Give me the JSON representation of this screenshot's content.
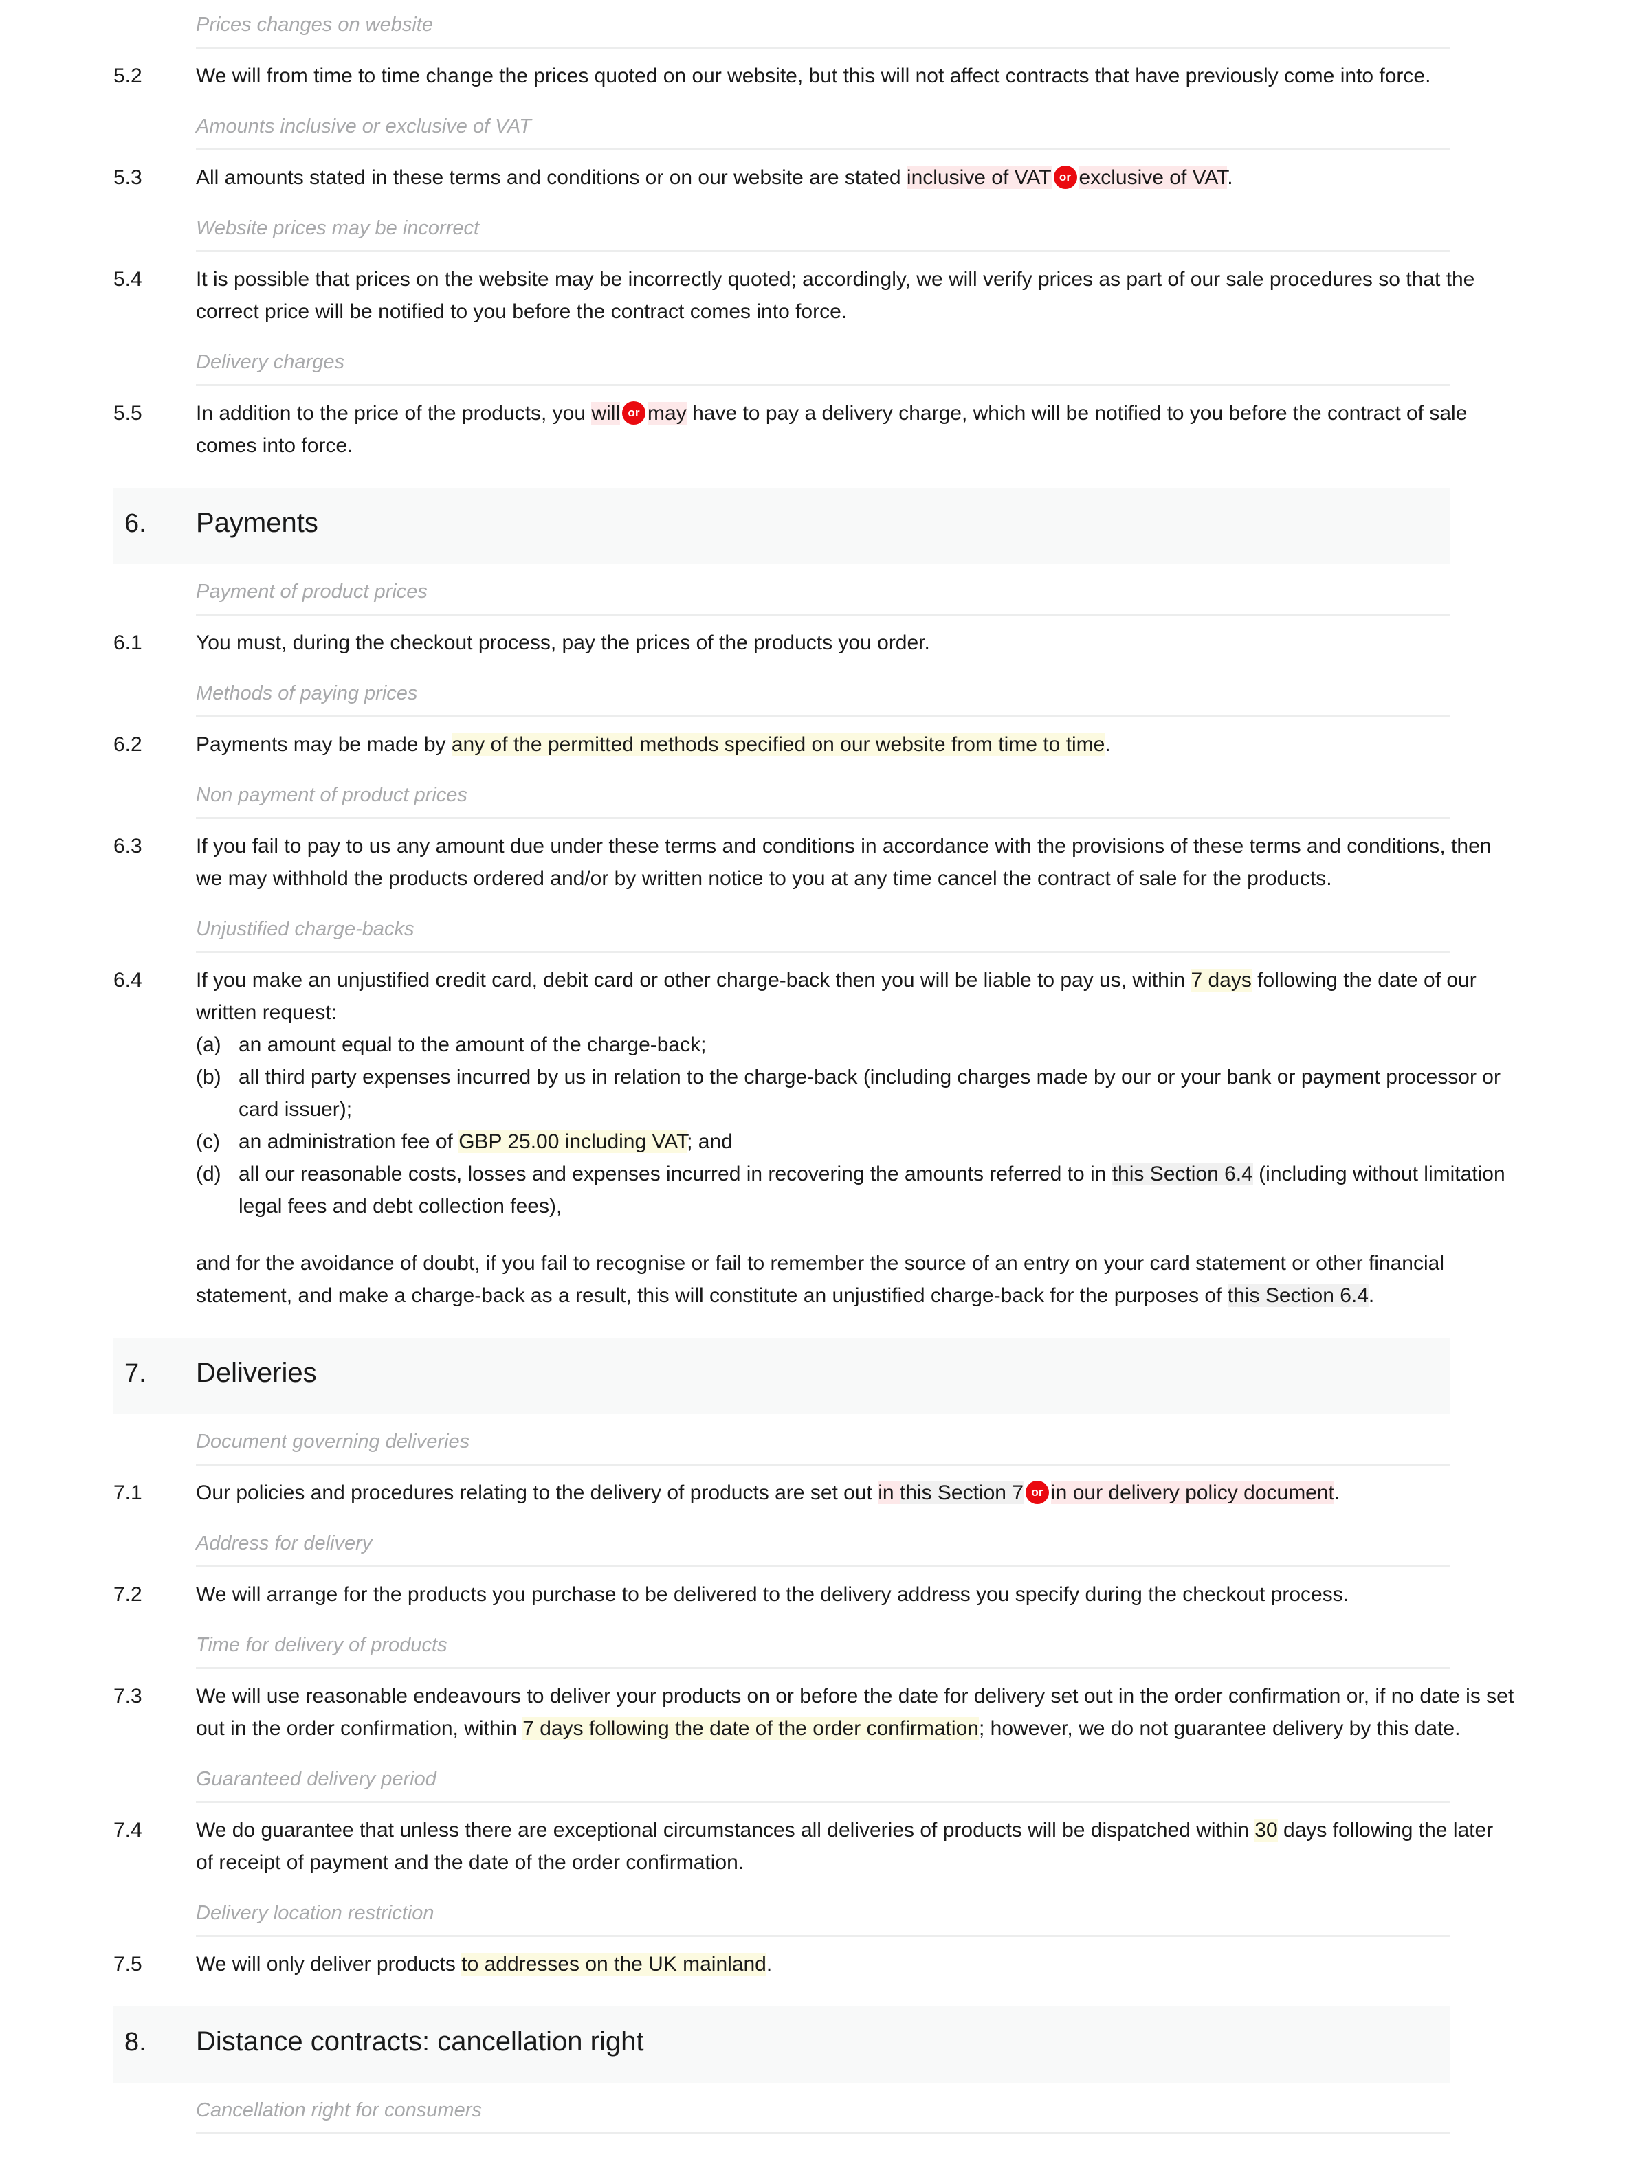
{
  "colors": {
    "text": "#1a1a1a",
    "subheading": "#a8a9ab",
    "rule": "#eceded",
    "section_band": "#f8f9f9",
    "highlight_pink": "#fde8e9",
    "highlight_yellow": "#fcfae0",
    "highlight_grey": "#f0f0f0",
    "or_badge": "#ea0a10"
  },
  "or_badge_label": "or",
  "blocks": {
    "sub_5_1": "Prices changes on website",
    "c_5_2_num": "5.2",
    "c_5_2_text": "We will from time to time change the prices quoted on our website, but this will not affect contracts that have previously come into force.",
    "sub_5_3": "Amounts inclusive or exclusive of VAT",
    "c_5_3_num": "5.3",
    "c_5_3_a": "All amounts stated in these terms and conditions or on our website are stated ",
    "c_5_3_opt1": "inclusive of VAT",
    "c_5_3_opt2": "exclusive of VAT",
    "c_5_3_b": ".",
    "sub_5_4": "Website prices may be incorrect",
    "c_5_4_num": "5.4",
    "c_5_4_text": "It is possible that prices on the website may be incorrectly quoted; accordingly, we will verify prices as part of our sale procedures so that the correct price will be notified to you before the contract comes into force.",
    "sub_5_5": "Delivery charges",
    "c_5_5_num": "5.5",
    "c_5_5_a": "In addition to the price of the products, you ",
    "c_5_5_opt1": "will",
    "c_5_5_opt2": "may",
    "c_5_5_b": " have to pay a delivery charge, which will be notified to you before the contract of sale comes into force.",
    "sec_6_num": "6.",
    "sec_6_title": "Payments",
    "sub_6_1": "Payment of product prices",
    "c_6_1_num": "6.1",
    "c_6_1_text": "You must, during the checkout process, pay the prices of the products you order.",
    "sub_6_2": "Methods of paying prices",
    "c_6_2_num": "6.2",
    "c_6_2_a": "Payments may be made by ",
    "c_6_2_hl": "any of the permitted methods specified on our website from time to time",
    "c_6_2_b": ".",
    "sub_6_3": "Non payment of product prices",
    "c_6_3_num": "6.3",
    "c_6_3_text": "If you fail to pay to us any amount due under these terms and conditions in accordance with the provisions of these terms and conditions, then we may withhold the products ordered and/or by written notice to you at any time cancel the contract of sale for the products.",
    "sub_6_4": "Unjustified charge-backs",
    "c_6_4_num": "6.4",
    "c_6_4_a": "If you make an unjustified credit card, debit card or other charge-back then you will be liable to pay us, within ",
    "c_6_4_hl": "7 days",
    "c_6_4_b": " following the date of our written request:",
    "c_6_4_items": [
      {
        "marker": "(a)",
        "text": "an amount equal to the amount of the charge-back;"
      },
      {
        "marker": "(b)",
        "text": "all third party expenses incurred by us in relation to the charge-back (including charges made by our or your bank or payment processor or card issuer);"
      },
      {
        "marker": "(c)",
        "pre": "an administration fee of ",
        "hl": "GBP 25.00 including VAT",
        "post": "; and"
      },
      {
        "marker": "(d)",
        "pre": "all our reasonable costs, losses and expenses incurred in recovering the amounts referred to in ",
        "ref": "this Section 6.4",
        "post": " (including without limitation legal fees and debt collection fees),"
      }
    ],
    "c_6_4_tail_a": "and for the avoidance of doubt, if you fail to recognise or fail to remember the source of an entry on your card statement or other financial statement, and make a charge-back as a result, this will constitute an unjustified charge-back for the purposes of ",
    "c_6_4_tail_ref": "this Section 6.4",
    "c_6_4_tail_b": ".",
    "sec_7_num": "7.",
    "sec_7_title": "Deliveries",
    "sub_7_1": "Document governing deliveries",
    "c_7_1_num": "7.1",
    "c_7_1_a": "Our policies and procedures relating to the delivery of products are set out ",
    "c_7_1_opt1_pre": "in ",
    "c_7_1_opt1_ref": "this Section 7",
    "c_7_1_opt2": "in our delivery policy document",
    "c_7_1_b": ".",
    "sub_7_2": "Address for delivery",
    "c_7_2_num": "7.2",
    "c_7_2_text": "We will arrange for the products you purchase to be delivered to the delivery address you specify during the checkout process.",
    "sub_7_3": "Time for delivery of products",
    "c_7_3_num": "7.3",
    "c_7_3_a": "We will use reasonable endeavours to deliver your products on or before the date for delivery set out in the order confirmation or, if no date is set out in the order confirmation, within ",
    "c_7_3_hl": "7 days following the date of the order confirmation",
    "c_7_3_b": "; however, we do not guarantee delivery by this date.",
    "sub_7_4": "Guaranteed delivery period",
    "c_7_4_num": "7.4",
    "c_7_4_a": "We do guarantee that unless there are exceptional circumstances all deliveries of products will be dispatched within ",
    "c_7_4_hl": "30",
    "c_7_4_b": " days following the later of receipt of payment and the date of the order confirmation.",
    "sub_7_5": "Delivery location restriction",
    "c_7_5_num": "7.5",
    "c_7_5_a": "We will only deliver products ",
    "c_7_5_hl": "to addresses on the UK mainland",
    "c_7_5_b": ".",
    "sec_8_num": "8.",
    "sec_8_title": "Distance contracts: cancellation right",
    "sub_8_1": "Cancellation right for consumers"
  }
}
